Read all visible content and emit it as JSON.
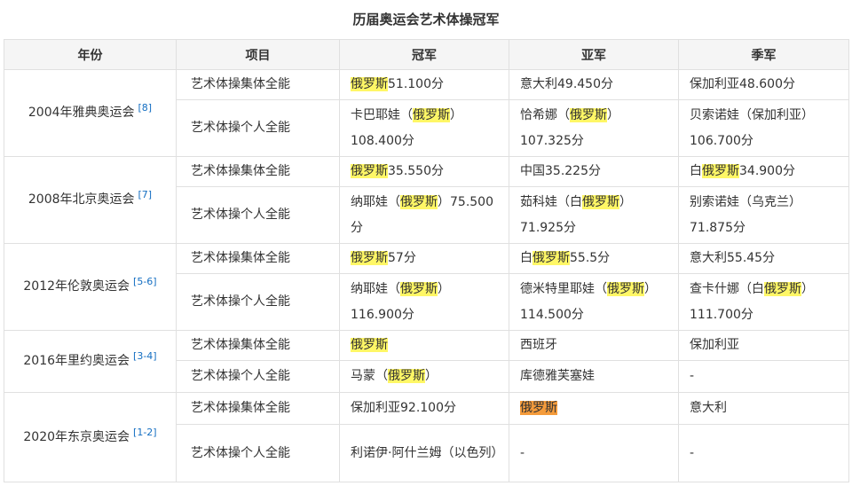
{
  "title": "历届奥运会艺术体操冠军",
  "headers": [
    "年份",
    "项目",
    "冠军",
    "亚军",
    "季军"
  ],
  "groups": [
    {
      "year": "2004年雅典奥运会",
      "ref": "[8]",
      "rows": [
        {
          "item": "艺术体操集体全能",
          "gold": [
            {
              "t": "俄罗斯",
              "hl": "y"
            },
            {
              "t": "51.100分"
            }
          ],
          "silver": [
            {
              "t": "意大利49.450分"
            }
          ],
          "bronze": [
            {
              "t": "保加利亚48.600分"
            }
          ]
        },
        {
          "item": "艺术体操个人全能",
          "gold": [
            {
              "t": "卡巴耶娃（"
            },
            {
              "t": "俄罗斯",
              "hl": "y"
            },
            {
              "t": "）108.400分"
            }
          ],
          "silver": [
            {
              "t": "恰希娜（"
            },
            {
              "t": "俄罗斯",
              "hl": "y"
            },
            {
              "t": "）107.325分"
            }
          ],
          "bronze": [
            {
              "t": "贝索诺娃（保加利亚）106.700分"
            }
          ]
        }
      ]
    },
    {
      "year": "2008年北京奥运会",
      "ref": "[7]",
      "rows": [
        {
          "item": "艺术体操集体全能",
          "gold": [
            {
              "t": "俄罗斯",
              "hl": "y"
            },
            {
              "t": "35.550分"
            }
          ],
          "silver": [
            {
              "t": "中国35.225分"
            }
          ],
          "bronze": [
            {
              "t": "白"
            },
            {
              "t": "俄罗斯",
              "hl": "y"
            },
            {
              "t": "34.900分"
            }
          ]
        },
        {
          "item": "艺术体操个人全能",
          "gold": [
            {
              "t": "纳耶娃（"
            },
            {
              "t": "俄罗斯",
              "hl": "y"
            },
            {
              "t": "）75.500分"
            }
          ],
          "silver": [
            {
              "t": "茹科娃（白"
            },
            {
              "t": "俄罗斯",
              "hl": "y"
            },
            {
              "t": "）71.925分"
            }
          ],
          "bronze": [
            {
              "t": "别索诺娃（乌克兰）71.875分"
            }
          ]
        }
      ]
    },
    {
      "year": "2012年伦敦奥运会",
      "ref": "[5-6]",
      "rows": [
        {
          "item": "艺术体操集体全能",
          "gold": [
            {
              "t": "俄罗斯",
              "hl": "y"
            },
            {
              "t": "57分"
            }
          ],
          "silver": [
            {
              "t": "白"
            },
            {
              "t": "俄罗斯",
              "hl": "y"
            },
            {
              "t": "55.5分"
            }
          ],
          "bronze": [
            {
              "t": "意大利55.45分"
            }
          ]
        },
        {
          "item": "艺术体操个人全能",
          "gold": [
            {
              "t": "纳耶娃（"
            },
            {
              "t": "俄罗斯",
              "hl": "y"
            },
            {
              "t": "）116.900分"
            }
          ],
          "silver": [
            {
              "t": "德米特里耶娃（"
            },
            {
              "t": "俄罗斯",
              "hl": "y"
            },
            {
              "t": "）114.500分"
            }
          ],
          "bronze": [
            {
              "t": "查卡什娜（白"
            },
            {
              "t": "俄罗斯",
              "hl": "y"
            },
            {
              "t": "）111.700分"
            }
          ]
        }
      ]
    },
    {
      "year": "2016年里约奥运会",
      "ref": "[3-4]",
      "rows": [
        {
          "item": "艺术体操集体全能",
          "gold": [
            {
              "t": "俄罗斯",
              "hl": "y"
            }
          ],
          "silver": [
            {
              "t": "西班牙"
            }
          ],
          "bronze": [
            {
              "t": "保加利亚"
            }
          ]
        },
        {
          "item": "艺术体操个人全能",
          "gold": [
            {
              "t": "马蒙（"
            },
            {
              "t": "俄罗斯",
              "hl": "y"
            },
            {
              "t": "）"
            }
          ],
          "silver": [
            {
              "t": "库德雅芙塞娃"
            }
          ],
          "bronze": [
            {
              "t": "-"
            }
          ]
        }
      ]
    },
    {
      "year": "2020年东京奥运会",
      "ref": "[1-2]",
      "rows": [
        {
          "item": "艺术体操集体全能",
          "gold": [
            {
              "t": "保加利亚92.100分"
            }
          ],
          "silver": [
            {
              "t": "俄罗斯",
              "hl": "o"
            }
          ],
          "bronze": [
            {
              "t": "意大利"
            }
          ]
        },
        {
          "item": "艺术体操个人全能",
          "gold": [
            {
              "t": "利诺伊·阿什兰姆（以色列）"
            }
          ],
          "silver": [
            {
              "t": "-"
            }
          ],
          "bronze": [
            {
              "t": "-"
            }
          ]
        }
      ]
    }
  ],
  "colors": {
    "highlight_yellow": "#fff766",
    "highlight_orange": "#f49b3b",
    "header_bg": "#f5f5f5",
    "border": "#e0e0e0",
    "ref_link": "#136ec2"
  }
}
